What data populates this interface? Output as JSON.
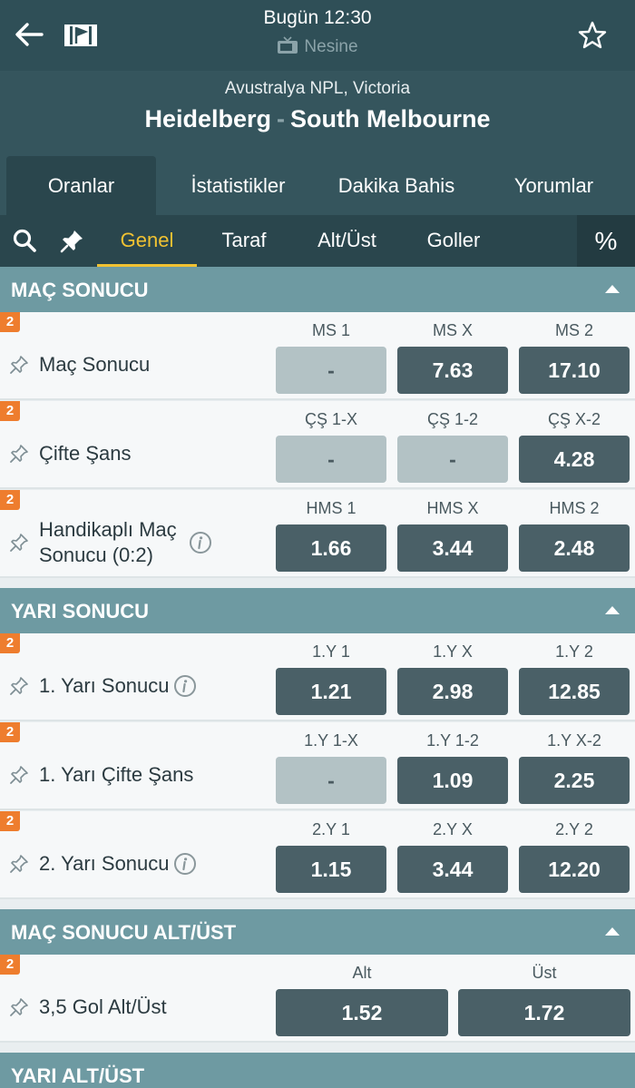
{
  "header": {
    "time": "Bugün 12:30",
    "channel": "Nesine"
  },
  "match": {
    "league": "Avustralya NPL, Victoria",
    "home": "Heidelberg",
    "separator": "-",
    "away": "South Melbourne"
  },
  "main_tabs": [
    "Oranlar",
    "İstatistikler",
    "Dakika Bahis",
    "Yorumlar"
  ],
  "sub_tabs": [
    "Genel",
    "Taraf",
    "Alt/Üst",
    "Goller"
  ],
  "percent_label": "%",
  "colors": {
    "accent": "#f1c232",
    "badge": "#ee7d2e",
    "odd": "#4a6067",
    "section": "#6e9aa2"
  },
  "sections": [
    {
      "title": "MAÇ SONUCU",
      "rows": [
        {
          "badge": "2",
          "name": "Maç Sonucu",
          "cols": [
            "MS 1",
            "MS X",
            "MS 2"
          ],
          "odds": [
            "-",
            "7.63",
            "17.10"
          ]
        },
        {
          "badge": "2",
          "name": "Çifte Şans",
          "cols": [
            "ÇŞ 1-X",
            "ÇŞ 1-2",
            "ÇŞ X-2"
          ],
          "odds": [
            "-",
            "-",
            "4.28"
          ]
        },
        {
          "badge": "2",
          "name_line1": "Handikaplı Maç",
          "name_line2": "Sonucu (0:2)",
          "cols": [
            "HMS 1",
            "HMS X",
            "HMS 2"
          ],
          "odds": [
            "1.66",
            "3.44",
            "2.48"
          ]
        }
      ]
    },
    {
      "title": "YARI SONUCU",
      "rows": [
        {
          "badge": "2",
          "name": "1. Yarı Sonucu",
          "cols": [
            "1.Y 1",
            "1.Y X",
            "1.Y 2"
          ],
          "odds": [
            "1.21",
            "2.98",
            "12.85"
          ]
        },
        {
          "badge": "2",
          "name": "1. Yarı Çifte Şans",
          "cols": [
            "1.Y 1-X",
            "1.Y 1-2",
            "1.Y X-2"
          ],
          "odds": [
            "-",
            "1.09",
            "2.25"
          ]
        },
        {
          "badge": "2",
          "name": "2. Yarı Sonucu",
          "cols": [
            "2.Y 1",
            "2.Y X",
            "2.Y 2"
          ],
          "odds": [
            "1.15",
            "3.44",
            "12.20"
          ]
        }
      ]
    },
    {
      "title": "MAÇ SONUCU ALT/ÜST",
      "rows": [
        {
          "badge": "2",
          "name": "3,5 Gol Alt/Üst",
          "cols": [
            "Alt",
            "Üst"
          ],
          "odds": [
            "1.52",
            "1.72"
          ]
        }
      ]
    },
    {
      "title": "YARI ALT/ÜST",
      "rows": []
    }
  ]
}
